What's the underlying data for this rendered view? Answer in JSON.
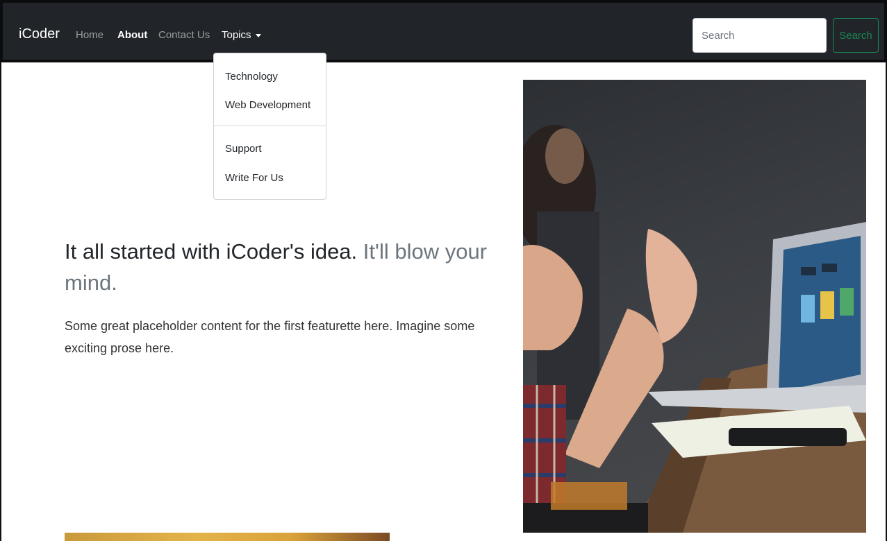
{
  "navbar": {
    "brand": "iCoder",
    "links": [
      {
        "label": "Home"
      },
      {
        "label": "About"
      },
      {
        "label": "Contact Us"
      },
      {
        "label": "Topics"
      }
    ],
    "active_link": "About",
    "search": {
      "placeholder": "Search",
      "value": ""
    },
    "search_button": "Search"
  },
  "dropdown": {
    "group1": [
      "Technology",
      "Web Development"
    ],
    "group2": [
      "Support",
      "Write For Us"
    ]
  },
  "featurette": {
    "heading_main": "It all started with iCoder's idea.",
    "heading_muted": "It'll blow your mind.",
    "lead": "Some great placeholder content for the first featurette here. Imagine some exciting prose here."
  },
  "colors": {
    "navbar_bg": "#212529",
    "search_button": "#198754",
    "muted_text": "#6c757d"
  }
}
